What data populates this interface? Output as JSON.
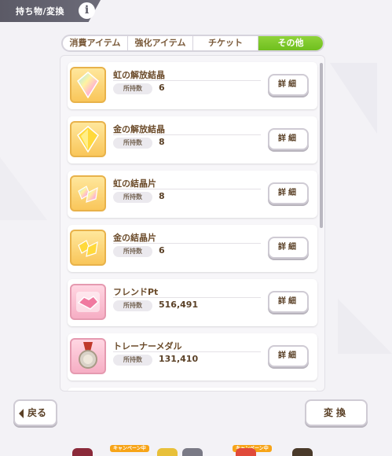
{
  "header": {
    "title": "持ち物/変換",
    "info_glyph": "i"
  },
  "tabs": [
    {
      "label": "消費アイテム",
      "active": false
    },
    {
      "label": "強化アイテム",
      "active": false
    },
    {
      "label": "チケット",
      "active": false
    },
    {
      "label": "その他",
      "active": true
    }
  ],
  "count_label": "所持数",
  "detail_label": "詳細",
  "items": [
    {
      "name": "虹の解放結晶",
      "count": "6",
      "icon": "rainbow-crystal-icon",
      "color": "#f9c65a"
    },
    {
      "name": "金の解放結晶",
      "count": "8",
      "icon": "gold-crystal-icon",
      "color": "#f9c65a"
    },
    {
      "name": "虹の結晶片",
      "count": "8",
      "icon": "rainbow-shard-icon",
      "color": "#f9c65a"
    },
    {
      "name": "金の結晶片",
      "count": "6",
      "icon": "gold-shard-icon",
      "color": "#f9c65a"
    },
    {
      "name": "フレンドPt",
      "count": "516,491",
      "icon": "handshake-icon",
      "color": "#f6aec4"
    },
    {
      "name": "トレーナーメダル",
      "count": "131,410",
      "icon": "medal-icon",
      "color": "#f6aec4"
    }
  ],
  "footer": {
    "back_label": "戻る",
    "exchange_label": "変換"
  },
  "bottom_badges": [
    "キャンペーン中",
    "キャンペーン中"
  ],
  "colors": {
    "tab_active": "#7cc82a",
    "text_brown": "#5a4026",
    "header_bg": "#5b5a66"
  }
}
